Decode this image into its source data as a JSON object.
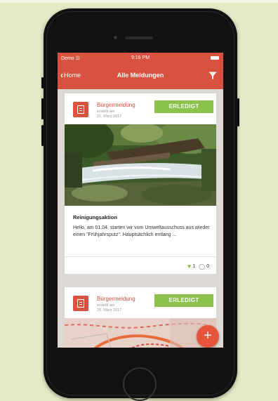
{
  "status_bar": {
    "carrier": "Demo ☰",
    "time": "9:16 PM"
  },
  "nav": {
    "back_label": "Home",
    "title": "Alle Meldungen"
  },
  "colors": {
    "primary": "#d9513f",
    "done_badge": "#8bc34a",
    "fab": "#e8533c"
  },
  "cards": [
    {
      "category": "Bürgermeldung",
      "meta_line1": "erstellt am",
      "meta_line2": "21. März 2017",
      "status": "ERLEDIGT",
      "image": "waterfall-photo",
      "title": "Reinigungsaktion",
      "body": "Hello, am 01.04. starten wir vom Umweltausschuss aus wieder einen \"Frühjahrsputz\". Hauptsächlich entlang ...",
      "likes": "1",
      "comments": "0"
    },
    {
      "category": "Bürgermeldung",
      "meta_line1": "erstellt am",
      "meta_line2": "20. März 2017",
      "status": "ERLEDIGT",
      "image": "map-snippet"
    }
  ],
  "fab": {
    "label": "+"
  }
}
